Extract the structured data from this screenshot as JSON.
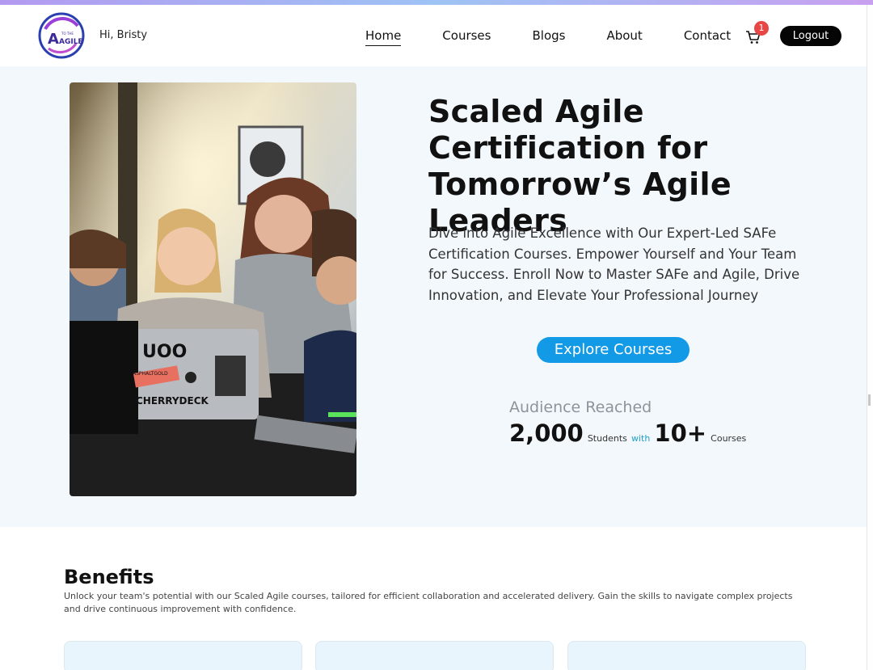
{
  "header": {
    "logo_text": "AGILE",
    "logo_small_text": "TO THE",
    "greeting": "Hi, Bristy",
    "nav": [
      {
        "label": "Home",
        "active": true
      },
      {
        "label": "Courses",
        "active": false
      },
      {
        "label": "Blogs",
        "active": false
      },
      {
        "label": "About",
        "active": false
      },
      {
        "label": "Contact",
        "active": false
      }
    ],
    "cart_icon": "shopping-cart-icon",
    "cart_count": "1",
    "logout_label": "Logout"
  },
  "hero": {
    "title": "Scaled Agile Certification for Tomorrow’s Agile Leaders",
    "description": "Dive into Agile Excellence with Our Expert-Led SAFe Certification Courses. Empower Yourself and Your Team for Success. Enroll Now to Master SAFe and Agile, Drive Innovation, and Elevate Your Professional Journey",
    "cta_label": "Explore Courses",
    "audience_label": "Audience Reached",
    "students_count": "2,000",
    "students_label": "Students",
    "with_label": "with",
    "courses_count": "10+",
    "courses_label": "Courses",
    "photo_laptop_brand": "CHERRYDECK",
    "photo_laptop_sticker": "ASPHALTGOLD"
  },
  "benefits": {
    "title": "Benefits",
    "description": "Unlock your team's potential with our Scaled Agile courses, tailored for efficient collaboration and accelerated delivery. Gain the skills to navigate complex projects and drive continuous improvement with confidence."
  },
  "colors": {
    "accent": "#129ae6",
    "hero_bg": "#f3f8fc",
    "badge": "#e84545",
    "logout_bg": "#050505"
  }
}
